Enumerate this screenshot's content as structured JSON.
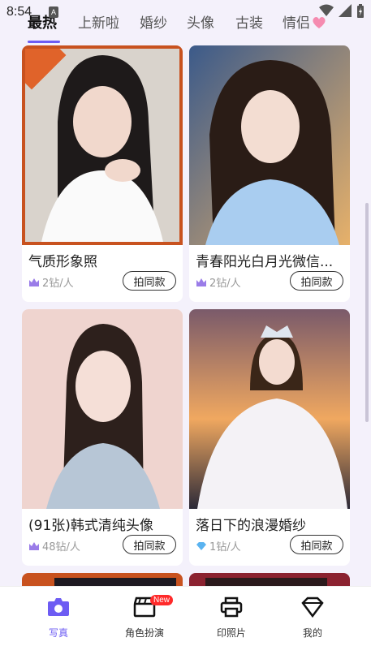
{
  "status_bar": {
    "time": "8:54",
    "notification_letter": "A"
  },
  "tabs": [
    {
      "label": "最热",
      "active": true
    },
    {
      "label": "上新啦",
      "active": false
    },
    {
      "label": "婚纱",
      "active": false
    },
    {
      "label": "头像",
      "active": false
    },
    {
      "label": "古装",
      "active": false
    },
    {
      "label": "情侣",
      "active": false
    }
  ],
  "cards": [
    {
      "title": "气质形象照",
      "cost": "2钻/人",
      "button": "拍同款"
    },
    {
      "title": "青春阳光白月光微信...",
      "cost": "2钻/人",
      "button": "拍同款"
    },
    {
      "title": "(91张)韩式清纯头像",
      "cost": "48钻/人",
      "button": "拍同款"
    },
    {
      "title": "落日下的浪漫婚纱",
      "cost": "1钻/人",
      "button": "拍同款"
    }
  ],
  "bottom_nav": [
    {
      "label": "写真",
      "icon": "camera-icon",
      "active": true
    },
    {
      "label": "角色扮演",
      "icon": "clapperboard-icon",
      "badge": "New",
      "active": false
    },
    {
      "label": "印照片",
      "icon": "printer-icon",
      "active": false
    },
    {
      "label": "我的",
      "icon": "diamond-icon",
      "active": false
    }
  ],
  "colors": {
    "accent": "#6d5cf3",
    "badge": "#ff2a2a",
    "frame": "#c8521f"
  }
}
